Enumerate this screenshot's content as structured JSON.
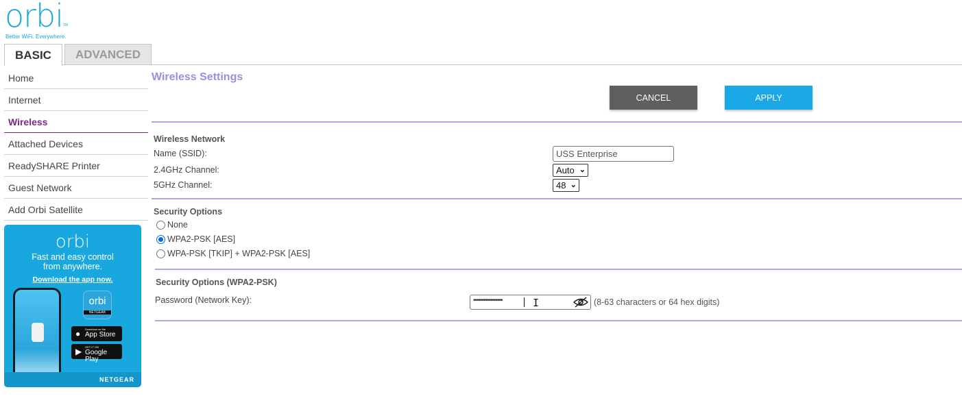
{
  "brand": {
    "logo_text": "orbi",
    "tm": "TM",
    "tagline": "Better WiFi. Everywhere."
  },
  "tabs": [
    {
      "label": "BASIC",
      "active": true
    },
    {
      "label": "ADVANCED",
      "active": false
    }
  ],
  "sidebar": {
    "items": [
      {
        "label": "Home"
      },
      {
        "label": "Internet"
      },
      {
        "label": "Wireless",
        "active": true
      },
      {
        "label": "Attached Devices"
      },
      {
        "label": "ReadySHARE Printer"
      },
      {
        "label": "Guest Network"
      },
      {
        "label": "Add Orbi Satellite"
      }
    ]
  },
  "promo": {
    "logo": "orbi",
    "tagline_line1": "Fast and easy control",
    "tagline_line2": "from anywhere.",
    "link": "Download the app now.",
    "app_tile_label": "orbi",
    "app_tile_brand": "NETGEAR",
    "app_store_small": "Download on the",
    "app_store_big": "App Store",
    "google_small": "GET IT ON",
    "google_big": "Google Play",
    "brand": "NETGEAR"
  },
  "main": {
    "title": "Wireless Settings",
    "cancel_label": "CANCEL",
    "apply_label": "APPLY",
    "wireless_network": {
      "title": "Wireless Network",
      "ssid_label": "Name (SSID):",
      "ssid_value": "USS Enterprise",
      "ch24_label": "2.4GHz Channel:",
      "ch24_value": "Auto",
      "ch5_label": "5GHz Channel:",
      "ch5_value": "48"
    },
    "security_options": {
      "title": "Security Options",
      "options": [
        {
          "label": "None",
          "selected": false
        },
        {
          "label": "WPA2-PSK [AES]",
          "selected": true
        },
        {
          "label": "WPA-PSK [TKIP] + WPA2-PSK [AES]",
          "selected": false
        }
      ]
    },
    "wpa2": {
      "title": "Security Options (WPA2-PSK)",
      "password_label": "Password (Network Key):",
      "password_mask": "•••••••••••••••••",
      "hint": "(8-63 characters or 64 hex digits)"
    }
  },
  "colors": {
    "accent_blue": "#1aa9e6",
    "title_purple": "#9a8fe0",
    "active_nav": "#7a2a86",
    "divider": "#b3a6e6"
  }
}
